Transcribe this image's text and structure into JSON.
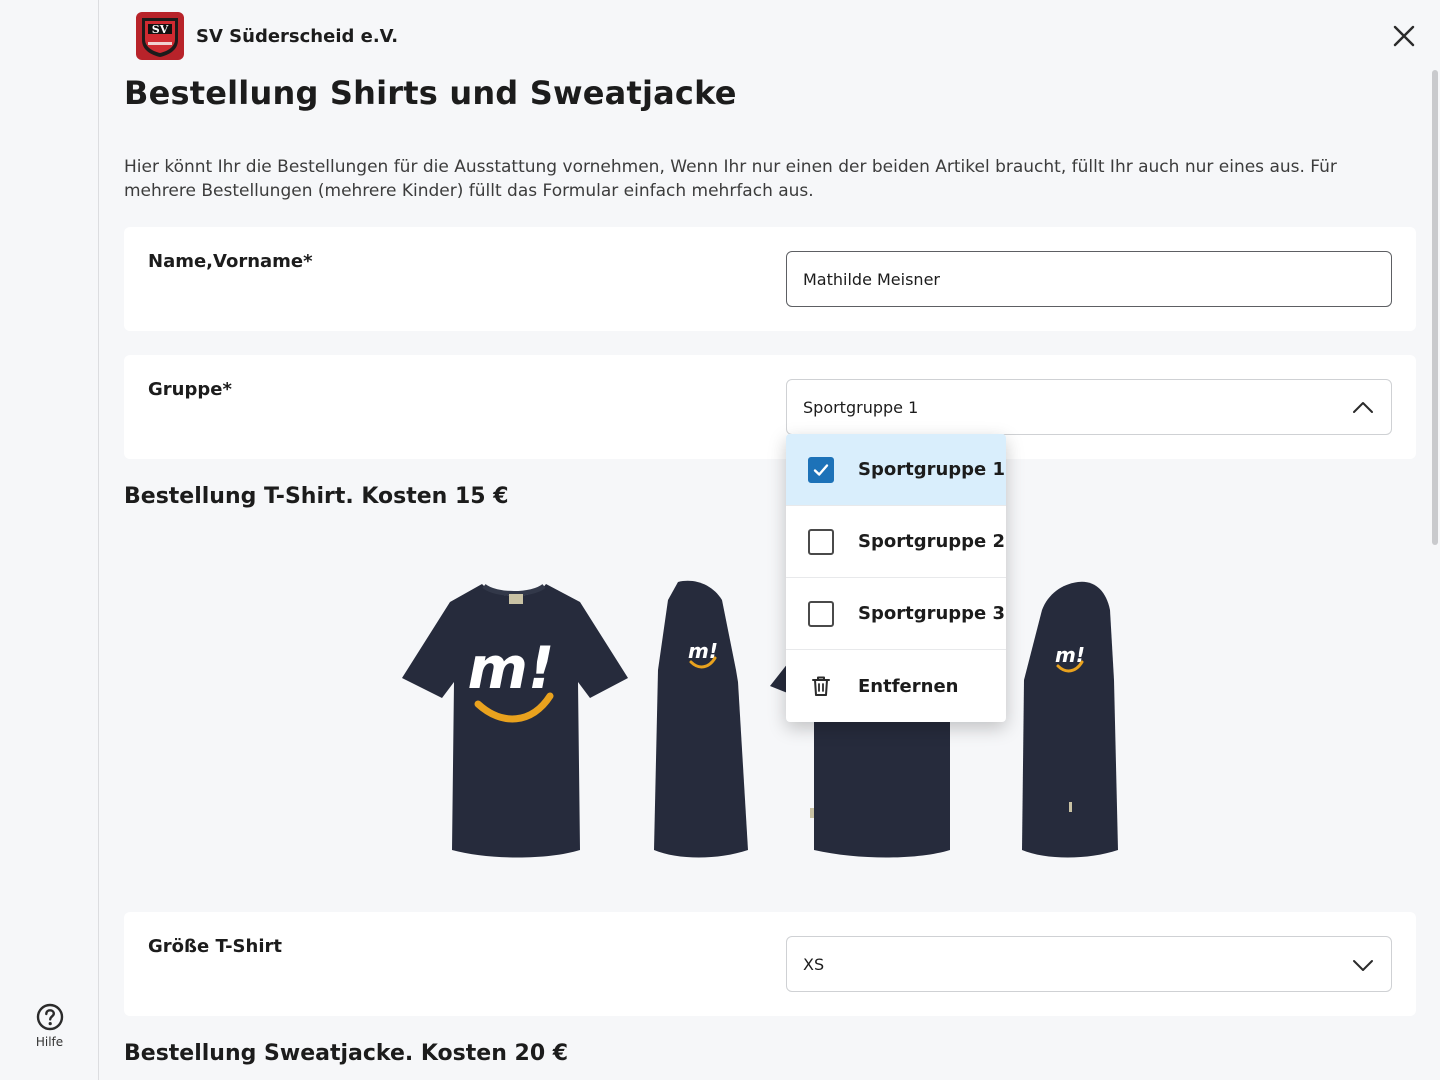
{
  "header": {
    "org_name": "SV Süderscheid e.V.",
    "logo_text": "SV"
  },
  "page": {
    "title": "Bestellung Shirts und Sweatjacke",
    "intro": "Hier könnt Ihr die Bestellungen für die Ausstattung vornehmen, Wenn Ihr nur einen der beiden Artikel braucht, füllt Ihr auch nur eines aus. Für mehrere Bestellungen (mehrere Kinder) füllt das Formular einfach mehrfach aus."
  },
  "form": {
    "name": {
      "label": "Name,Vorname*",
      "value": "Mathilde Meisner"
    },
    "group": {
      "label": "Gruppe*",
      "value": "Sportgruppe 1",
      "options": [
        {
          "label": "Sportgruppe 1",
          "checked": true
        },
        {
          "label": "Sportgruppe 2",
          "checked": false
        },
        {
          "label": "Sportgruppe 3",
          "checked": false
        }
      ],
      "remove_label": "Entfernen"
    },
    "tshirt_section_title": "Bestellung T-Shirt. Kosten 15 €",
    "tshirt_size": {
      "label": "Größe T-Shirt",
      "value": "XS"
    },
    "sweatjacket_section_title": "Bestellung Sweatjacke. Kosten 20 €"
  },
  "sidebar": {
    "help_label": "Hilfe"
  },
  "colors": {
    "accent": "#1d72b8",
    "selected_bg": "#d9eefc",
    "shirt": "#262b3c",
    "smile": "#e9a21e"
  },
  "icons": [
    "logo",
    "close-icon",
    "chevron-up-icon",
    "chevron-down-icon",
    "checkbox-icon",
    "trash-icon",
    "help-icon"
  ]
}
